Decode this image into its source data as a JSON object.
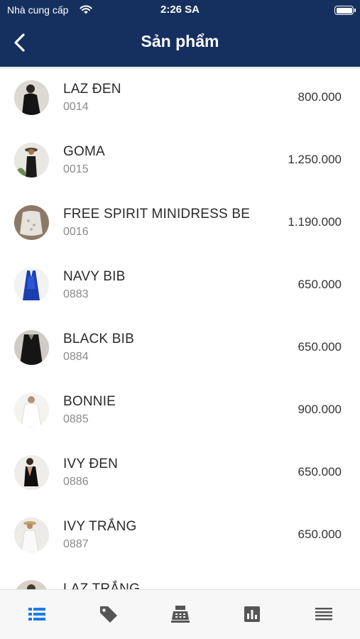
{
  "status_bar": {
    "carrier": "Nhà cung cấp",
    "time": "2:26 SA"
  },
  "header": {
    "title": "Sản phẩm"
  },
  "products": [
    {
      "name": "LAZ ĐEN",
      "code": "0014",
      "price": "800.000"
    },
    {
      "name": "GOMA",
      "code": "0015",
      "price": "1.250.000"
    },
    {
      "name": "FREE SPIRIT MINIDRESS BE",
      "code": "0016",
      "price": "1.190.000"
    },
    {
      "name": "NAVY BIB",
      "code": "0883",
      "price": "650.000"
    },
    {
      "name": "BLACK BIB",
      "code": "0884",
      "price": "650.000"
    },
    {
      "name": "BONNIE",
      "code": "0885",
      "price": "900.000"
    },
    {
      "name": "IVY ĐEN",
      "code": "0886",
      "price": "650.000"
    },
    {
      "name": "IVY TRẮNG",
      "code": "0887",
      "price": "650.000"
    },
    {
      "name": "LAZ TRẮNG",
      "code": "",
      "price": ""
    }
  ],
  "tabbar": {
    "items": [
      "products-list",
      "tags",
      "cash-register",
      "reports",
      "menu"
    ],
    "active": "products-list",
    "active_color": "#1f7be0",
    "inactive_color": "#555555"
  },
  "colors": {
    "header_bg": "#15305e"
  }
}
